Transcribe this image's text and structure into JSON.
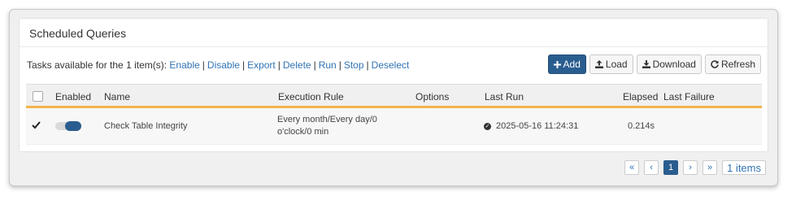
{
  "panel": {
    "title": "Scheduled Queries"
  },
  "tasks": {
    "prefix": "Tasks available for the 1 item(s):",
    "actions": [
      "Enable",
      "Disable",
      "Export",
      "Delete",
      "Run",
      "Stop",
      "Deselect"
    ]
  },
  "toolbar": {
    "add_label": "Add",
    "load_label": "Load",
    "download_label": "Download",
    "refresh_label": "Refresh"
  },
  "table": {
    "headers": [
      "Enabled",
      "Name",
      "Execution Rule",
      "Options",
      "Last Run",
      "Elapsed",
      "Last Failure"
    ],
    "rows": [
      {
        "checked": true,
        "enabled": true,
        "name": "Check Table Integrity",
        "rule_line1": "Every month/Every day/0",
        "rule_line2": "o'clock/0 min",
        "options": "",
        "last_run": "2025-05-16 11:24:31",
        "elapsed": "0.214s",
        "last_failure": ""
      }
    ]
  },
  "pager": {
    "first": "«",
    "prev": "‹",
    "current": "1",
    "next": "›",
    "last": "»",
    "items": "1 items"
  },
  "colors": {
    "accent": "#2a5d8f",
    "link": "#3173b5",
    "header_underline": "#f3b54a"
  }
}
